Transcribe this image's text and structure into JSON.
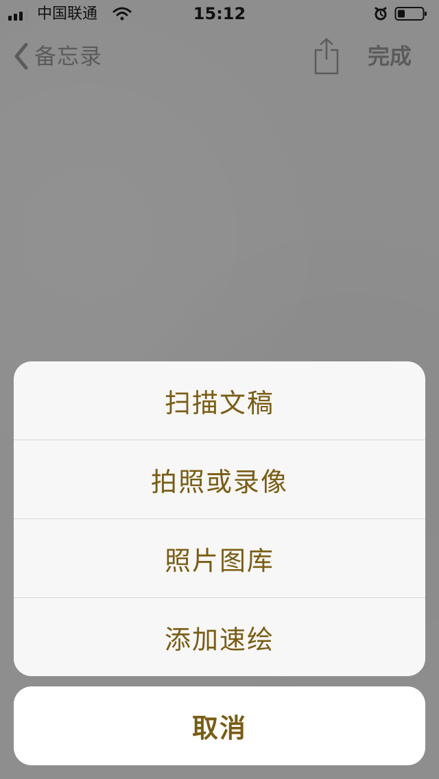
{
  "status_bar": {
    "carrier": "中国联通",
    "time": "15:12",
    "icons": [
      "signal-icon",
      "wifi-icon",
      "alarm-icon",
      "battery-icon"
    ]
  },
  "nav": {
    "back_label": "备忘录",
    "done_label": "完成",
    "share_icon": "share-icon"
  },
  "action_sheet": {
    "items": [
      {
        "label": "扫描文稿"
      },
      {
        "label": "拍照或录像"
      },
      {
        "label": "照片图库"
      },
      {
        "label": "添加速绘"
      }
    ],
    "cancel_label": "取消"
  },
  "colors": {
    "background": "#8e8e8e",
    "accent": "#7a5d12",
    "sheet": "#f7f7f7",
    "cancel_bg": "#ffffff",
    "nav_text": "#5b5b5b"
  }
}
